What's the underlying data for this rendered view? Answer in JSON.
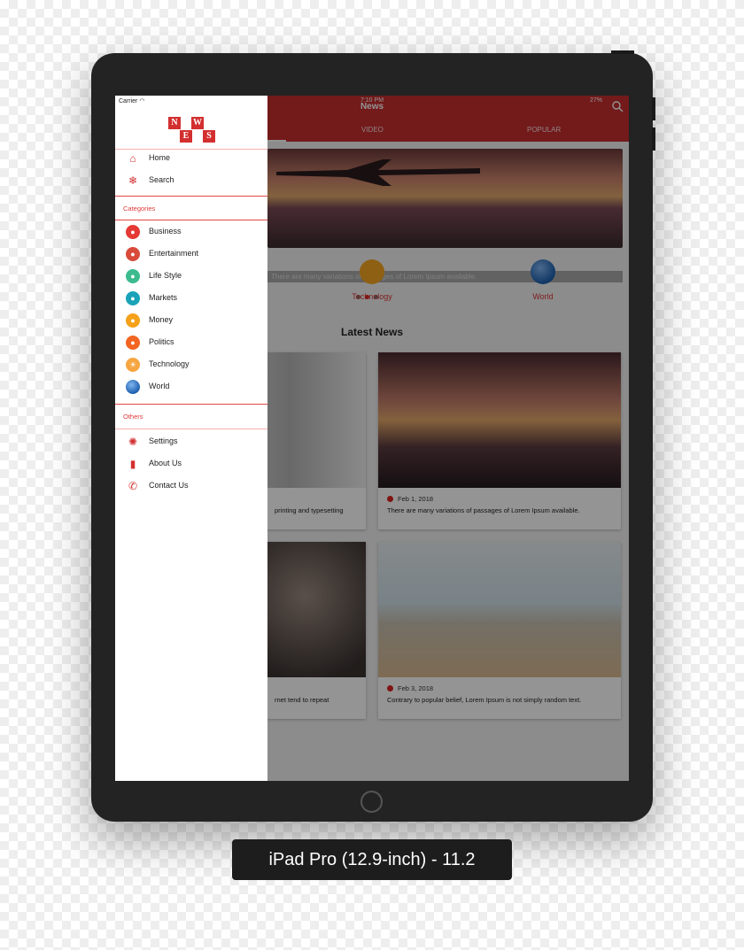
{
  "device_label": "iPad Pro (12.9-inch) - 11.2",
  "status": {
    "carrier": "Carrier",
    "time": "7:10 PM",
    "battery": "27%"
  },
  "header": {
    "title": "News",
    "search_icon": "search-icon"
  },
  "tabs": [
    {
      "label": "VIDEO"
    },
    {
      "label": "POPULAR"
    }
  ],
  "hero": {
    "caption": "There are many variations of passages of Lorem Ipsum available."
  },
  "categories_row": [
    {
      "label": "Technology",
      "color": "#f5a623"
    },
    {
      "label": "World",
      "color": "#1e5fb0"
    }
  ],
  "latest_title": "Latest News",
  "cards": [
    {
      "date": "",
      "text": "printing and typesetting"
    },
    {
      "date": "Feb 1, 2018",
      "text": "There are many variations of passages of Lorem Ipsum available."
    },
    {
      "date": "",
      "text": "rnet tend to repeat"
    },
    {
      "date": "Feb 3, 2018",
      "text": "Contrary to popular belief, Lorem Ipsum is not simply random text."
    }
  ],
  "drawer": {
    "logo_letters": [
      "N",
      "W",
      "E",
      "S"
    ],
    "nav": [
      {
        "label": "Home",
        "icon": "home-icon"
      },
      {
        "label": "Search",
        "icon": "snowflake-icon"
      }
    ],
    "categories_title": "Categories",
    "categories": [
      {
        "label": "Business",
        "color": "#e53935"
      },
      {
        "label": "Entertainment",
        "color": "#d84b3a"
      },
      {
        "label": "Life Style",
        "color": "#3dbb8e"
      },
      {
        "label": "Markets",
        "color": "#1aa3b8"
      },
      {
        "label": "Money",
        "color": "#f5a11a"
      },
      {
        "label": "Politics",
        "color": "#f26522"
      },
      {
        "label": "Technology",
        "color": "#f7a540"
      },
      {
        "label": "World",
        "color": "#1e5fb0"
      }
    ],
    "others_title": "Others",
    "others": [
      {
        "label": "Settings",
        "icon": "gear-icon"
      },
      {
        "label": "About Us",
        "icon": "bookmark-icon"
      },
      {
        "label": "Contact Us",
        "icon": "phone-icon"
      }
    ]
  },
  "accent": "#d32f2f"
}
